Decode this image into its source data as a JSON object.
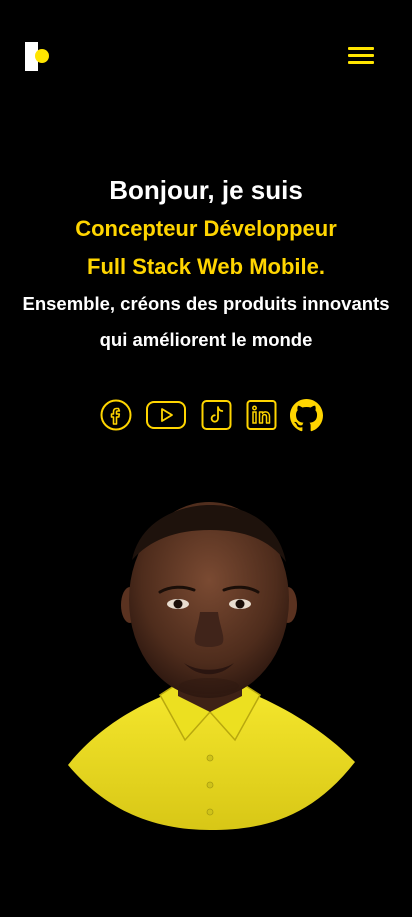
{
  "header": {
    "logo_icon": "brand-logo-icon",
    "menu_icon": "hamburger-menu-icon"
  },
  "hero": {
    "greeting": "Bonjour, je suis",
    "role_line1": "Concepteur Développeur",
    "role_line2": "Full Stack Web Mobile.",
    "tagline_line1": "Ensemble, créons des produits innovants",
    "tagline_line2": "qui améliorent le monde"
  },
  "socials": [
    {
      "icon": "facebook-icon"
    },
    {
      "icon": "youtube-icon"
    },
    {
      "icon": "tiktok-icon"
    },
    {
      "icon": "linkedin-icon"
    },
    {
      "icon": "github-icon"
    }
  ],
  "colors": {
    "background": "#000000",
    "accent": "#ffd500",
    "text": "#ffffff"
  }
}
